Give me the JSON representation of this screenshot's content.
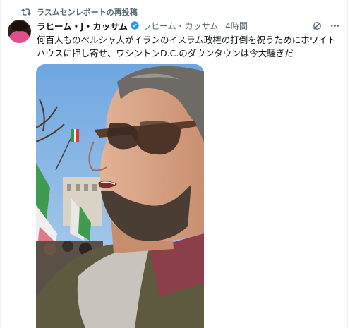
{
  "repost": {
    "label": "ラスムセンレポートの再投稿",
    "icon": "repost-icon"
  },
  "post": {
    "author_name": "ラヒーム・J・カッサム",
    "verified_icon": "verified-badge-icon",
    "handle": "ラヒーム・カッサム",
    "separator": "·",
    "time": "4時間",
    "text": "何百人ものペルシャ人がイランのイスラム政権の打倒を祝うためにホワイトハウスに押し寄せ、ワシントンD.C.のダウンタウンは今大騒ぎだ",
    "media": {
      "type": "video",
      "description_icon": "video-thumbnail"
    }
  },
  "actions": {
    "grok_icon": "grok-icon",
    "more_icon": "more-icon"
  },
  "colors": {
    "text": "#0f1419",
    "muted": "#536471",
    "verified": "#1d9bf0",
    "border": "#eff3f4"
  }
}
